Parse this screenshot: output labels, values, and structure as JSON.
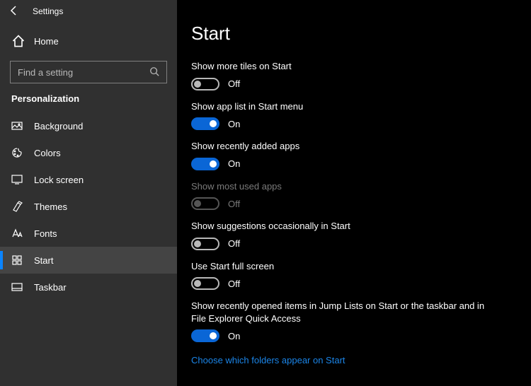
{
  "app_title": "Settings",
  "home_label": "Home",
  "search_placeholder": "Find a setting",
  "category": "Personalization",
  "sidebar": {
    "items": [
      {
        "label": "Background"
      },
      {
        "label": "Colors"
      },
      {
        "label": "Lock screen"
      },
      {
        "label": "Themes"
      },
      {
        "label": "Fonts"
      },
      {
        "label": "Start"
      },
      {
        "label": "Taskbar"
      }
    ]
  },
  "page_title": "Start",
  "toggle_on_text": "On",
  "toggle_off_text": "Off",
  "settings": [
    {
      "label": "Show more tiles on Start",
      "value": false,
      "disabled": false
    },
    {
      "label": "Show app list in Start menu",
      "value": true,
      "disabled": false
    },
    {
      "label": "Show recently added apps",
      "value": true,
      "disabled": false
    },
    {
      "label": "Show most used apps",
      "value": false,
      "disabled": true
    },
    {
      "label": "Show suggestions occasionally in Start",
      "value": false,
      "disabled": false
    },
    {
      "label": "Use Start full screen",
      "value": false,
      "disabled": false
    },
    {
      "label": "Show recently opened items in Jump Lists on Start or the taskbar and in File Explorer Quick Access",
      "value": true,
      "disabled": false
    }
  ],
  "link_text": "Choose which folders appear on Start"
}
